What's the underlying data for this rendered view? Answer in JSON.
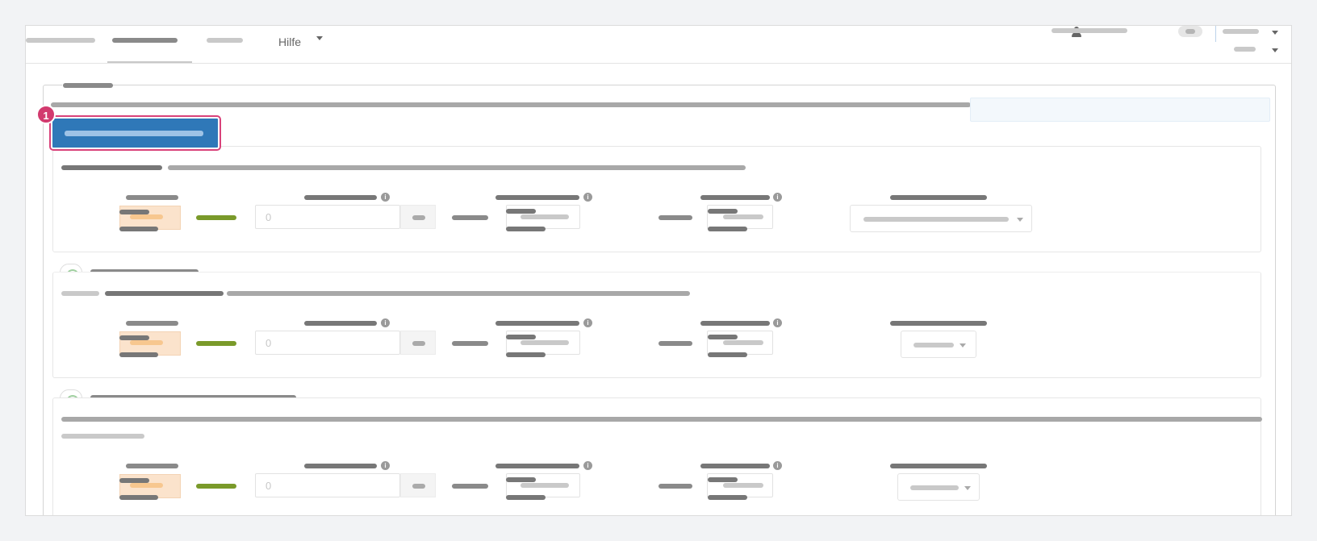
{
  "nav": {
    "help_label": "Hilfe"
  },
  "badge": "1",
  "rows": [
    {
      "amount_value": "0"
    },
    {
      "amount_value": "0"
    },
    {
      "amount_value": "0"
    }
  ],
  "colors": {
    "primary": "#2f78b8",
    "highlight": "#d23a6e",
    "status_green": "#7a9a2a",
    "orange_bg": "#fbe3cc"
  }
}
